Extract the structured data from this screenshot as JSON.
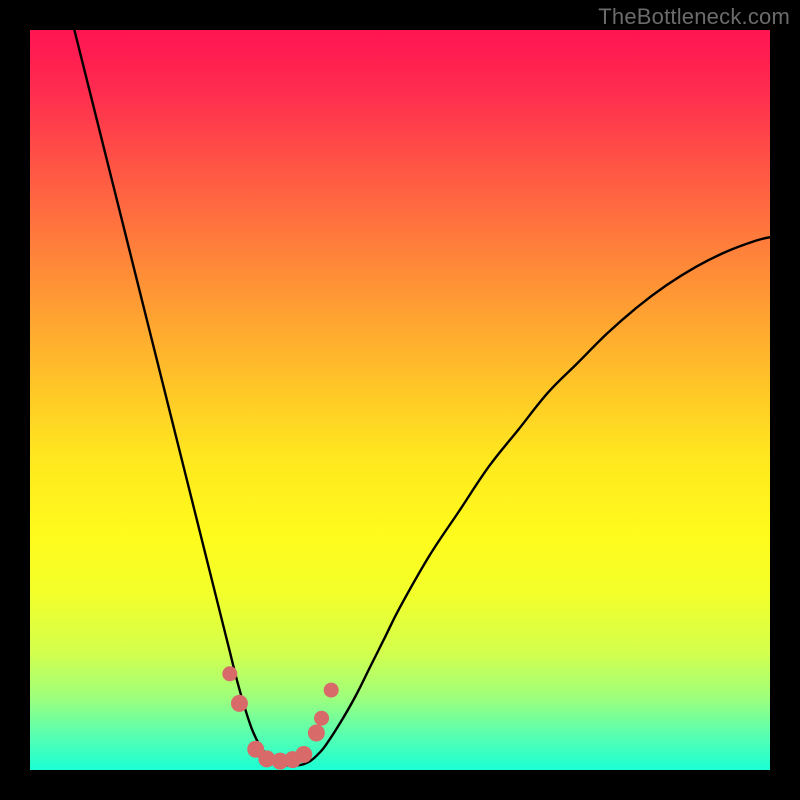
{
  "attribution": "TheBottleneck.com",
  "chart_data": {
    "type": "line",
    "title": "",
    "xlabel": "",
    "ylabel": "",
    "xlim": [
      0,
      100
    ],
    "ylim": [
      0,
      100
    ],
    "series": [
      {
        "name": "curve",
        "x": [
          6,
          8,
          10,
          12,
          14,
          16,
          18,
          20,
          22,
          24,
          26,
          27,
          28,
          29,
          30,
          31,
          32,
          33,
          34,
          35,
          36,
          37,
          38,
          39,
          40,
          42,
          44,
          46,
          48,
          50,
          54,
          58,
          62,
          66,
          70,
          74,
          78,
          82,
          86,
          90,
          94,
          98,
          100
        ],
        "values": [
          100,
          92,
          84,
          76,
          68,
          60,
          52,
          44,
          36,
          28,
          20,
          16,
          12,
          8.5,
          5.5,
          3.4,
          2.0,
          1.2,
          0.8,
          0.6,
          0.6,
          0.8,
          1.3,
          2.2,
          3.4,
          6.5,
          10,
          14,
          18,
          22,
          29,
          35,
          41,
          46,
          51,
          55,
          59,
          62.5,
          65.5,
          68,
          70,
          71.5,
          72
        ]
      }
    ],
    "markers": {
      "name": "highlight-points",
      "x_index_percent": [
        27.0,
        28.3,
        30.5,
        32.0,
        33.8,
        35.5,
        37.0,
        38.7,
        39.4,
        40.7
      ],
      "y_percent": [
        13.0,
        9.0,
        2.8,
        1.5,
        1.2,
        1.4,
        2.1,
        5.0,
        7.0,
        10.8
      ],
      "radius_px": [
        7.5,
        8.5,
        8.5,
        8.5,
        8.5,
        8.5,
        8.5,
        8.5,
        7.5,
        7.5
      ]
    },
    "background_gradient": {
      "top": "#ff1452",
      "mid": "#ffe81f",
      "bottom": "#1bffd4"
    }
  }
}
